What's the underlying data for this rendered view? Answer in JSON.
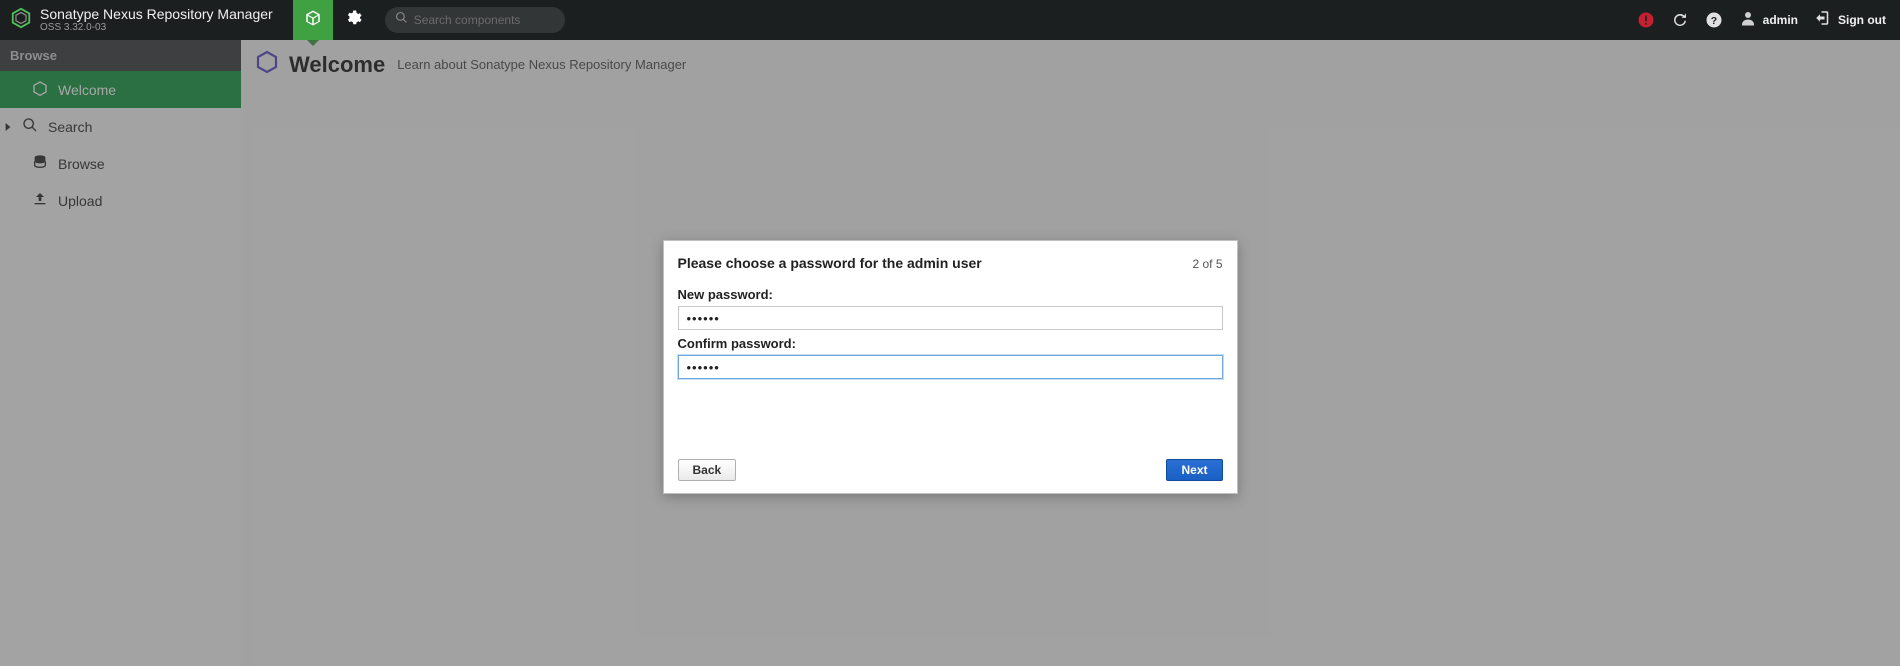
{
  "header": {
    "title": "Sonatype Nexus Repository Manager",
    "version": "OSS 3.32.0-03",
    "search_placeholder": "Search components",
    "user": "admin",
    "signout": "Sign out"
  },
  "sidebar": {
    "section": "Browse",
    "items": [
      {
        "label": "Welcome",
        "icon": "home-outline-icon",
        "active": true
      },
      {
        "label": "Search",
        "icon": "search-icon",
        "caret": true
      },
      {
        "label": "Browse",
        "icon": "database-icon"
      },
      {
        "label": "Upload",
        "icon": "upload-icon"
      }
    ]
  },
  "page": {
    "title": "Welcome",
    "subtitle": "Learn about Sonatype Nexus Repository Manager"
  },
  "modal": {
    "title": "Please choose a password for the admin user",
    "step": "2 of 5",
    "new_password_label": "New password:",
    "confirm_password_label": "Confirm password:",
    "new_password_value": "••••••",
    "confirm_password_value": "••••••",
    "back": "Back",
    "next": "Next"
  }
}
